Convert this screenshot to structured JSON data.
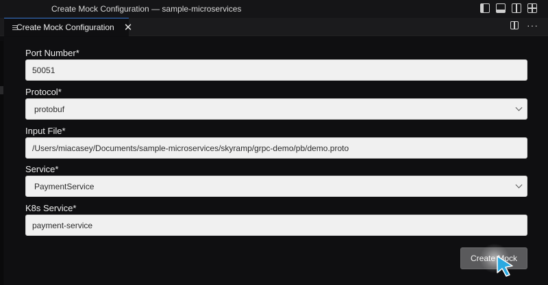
{
  "window": {
    "title": "Create Mock Configuration — sample-microservices",
    "layout_icons": [
      "primary-sidebar-icon",
      "panel-icon",
      "secondary-sidebar-icon",
      "customize-layout-icon"
    ]
  },
  "tab": {
    "label": "Create Mock Configuration",
    "close_glyph": "✕",
    "file_icon": "menu-lines-icon"
  },
  "tab_actions": {
    "split_icon": "split-editor-icon",
    "more_glyph": "···"
  },
  "form": {
    "port": {
      "label": "Port Number*",
      "value": "50051"
    },
    "protocol": {
      "label": "Protocol*",
      "value": "protobuf"
    },
    "input_file": {
      "label": "Input File*",
      "value": "/Users/miacasey/Documents/sample-microservices/skyramp/grpc-demo/pb/demo.proto"
    },
    "service": {
      "label": "Service*",
      "value": "PaymentService"
    },
    "k8s_service": {
      "label": "K8s Service*",
      "value": "payment-service"
    },
    "submit_label": "Create Mock"
  },
  "colors": {
    "accent_cursor": "#2aa9e0",
    "button_bg": "#5a5a5c",
    "field_bg": "#f0f0f0"
  }
}
